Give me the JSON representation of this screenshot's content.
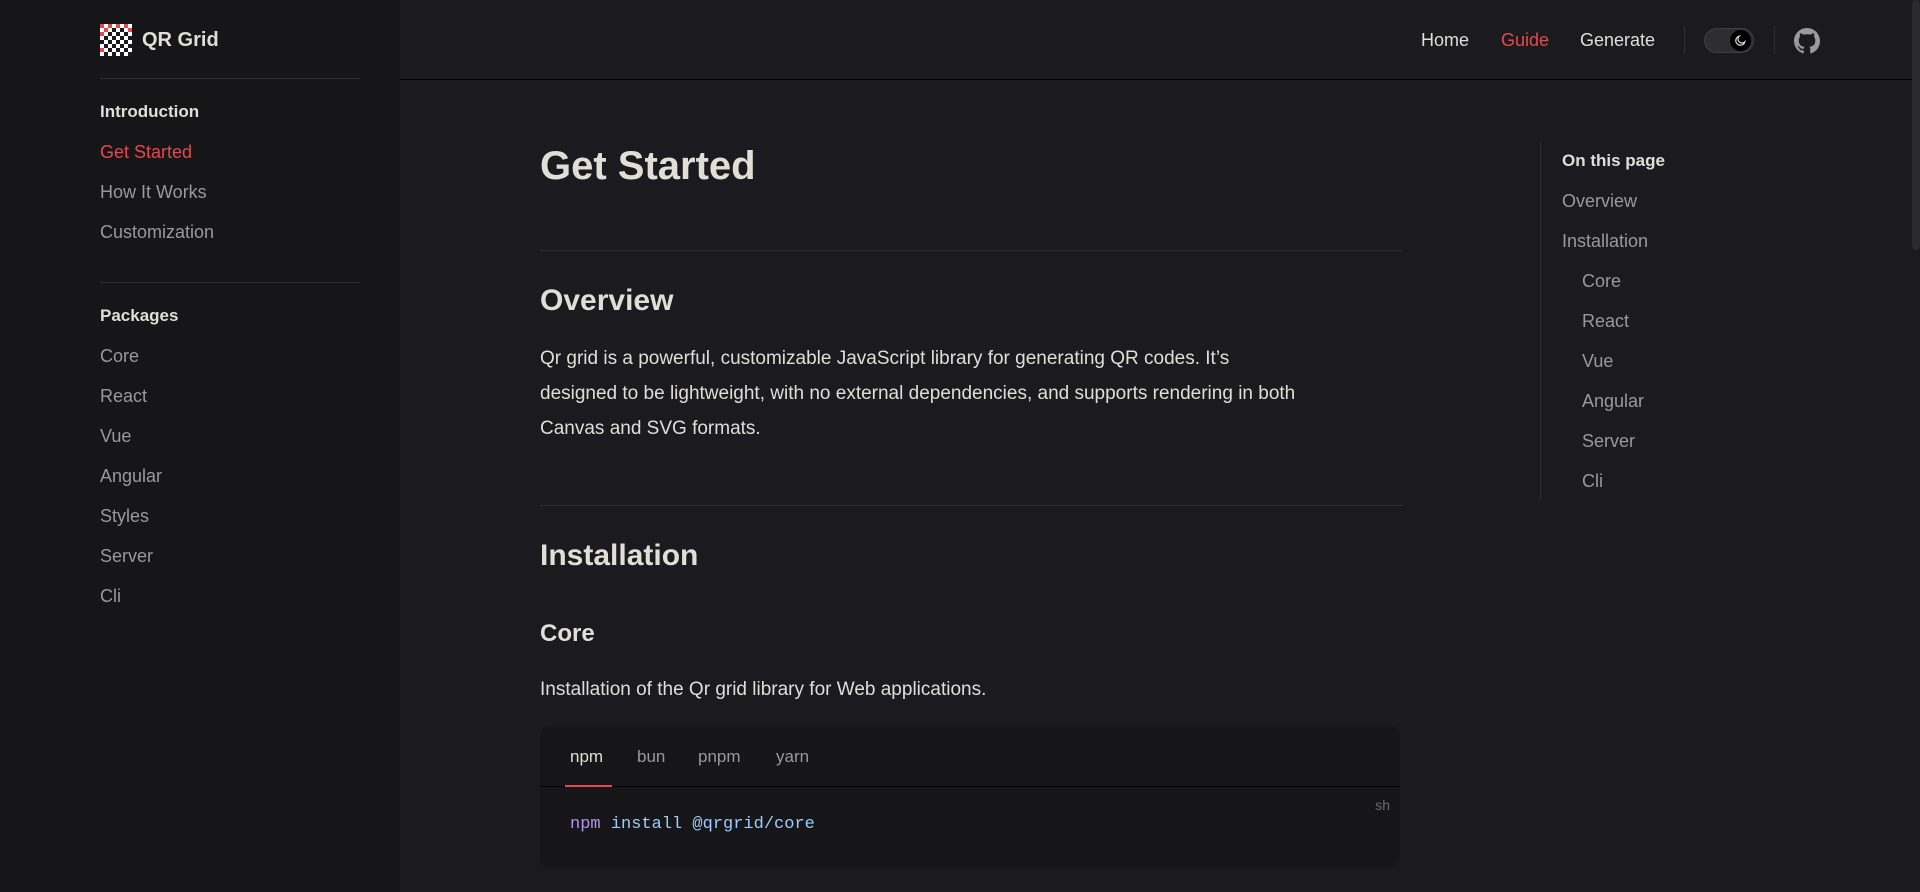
{
  "brand": {
    "name": "QR Grid",
    "logo_icon": "qr-checker-logo"
  },
  "sidebar": {
    "groups": [
      {
        "title": "Introduction",
        "items": [
          {
            "label": "Get Started",
            "active": true
          },
          {
            "label": "How It Works"
          },
          {
            "label": "Customization"
          }
        ]
      },
      {
        "title": "Packages",
        "items": [
          {
            "label": "Core"
          },
          {
            "label": "React"
          },
          {
            "label": "Vue"
          },
          {
            "label": "Angular"
          },
          {
            "label": "Styles"
          },
          {
            "label": "Server"
          },
          {
            "label": "Cli"
          }
        ]
      }
    ]
  },
  "topnav": {
    "links": [
      {
        "label": "Home"
      },
      {
        "label": "Guide",
        "active": true
      },
      {
        "label": "Generate"
      }
    ],
    "theme_toggle_icon": "moon-icon",
    "github_icon": "github-icon"
  },
  "main": {
    "title": "Get Started",
    "overview": {
      "heading": "Overview",
      "lines": [
        "Qr grid is a powerful, customizable JavaScript library for generating QR codes. It’s",
        "designed to be lightweight, with no external dependencies, and supports rendering in both",
        "Canvas and SVG formats."
      ]
    },
    "installation": {
      "heading": "Installation",
      "core": {
        "heading": "Core",
        "description": "Installation of the Qr grid library for Web applications.",
        "code_tabs": [
          {
            "label": "npm",
            "active": true
          },
          {
            "label": "bun"
          },
          {
            "label": "pnpm"
          },
          {
            "label": "yarn"
          }
        ],
        "language": "sh",
        "command": {
          "cmd": "npm",
          "rest": "install @qrgrid/core"
        }
      }
    }
  },
  "toc": {
    "title": "On this page",
    "items": [
      {
        "label": "Overview"
      },
      {
        "label": "Installation"
      },
      {
        "label": "Core"
      },
      {
        "label": "React"
      },
      {
        "label": "Vue"
      },
      {
        "label": "Angular"
      },
      {
        "label": "Server"
      },
      {
        "label": "Cli"
      }
    ]
  },
  "colors": {
    "accent": "#e5484d",
    "background": "#1b1b1f",
    "sidebar_bg": "#161618"
  }
}
